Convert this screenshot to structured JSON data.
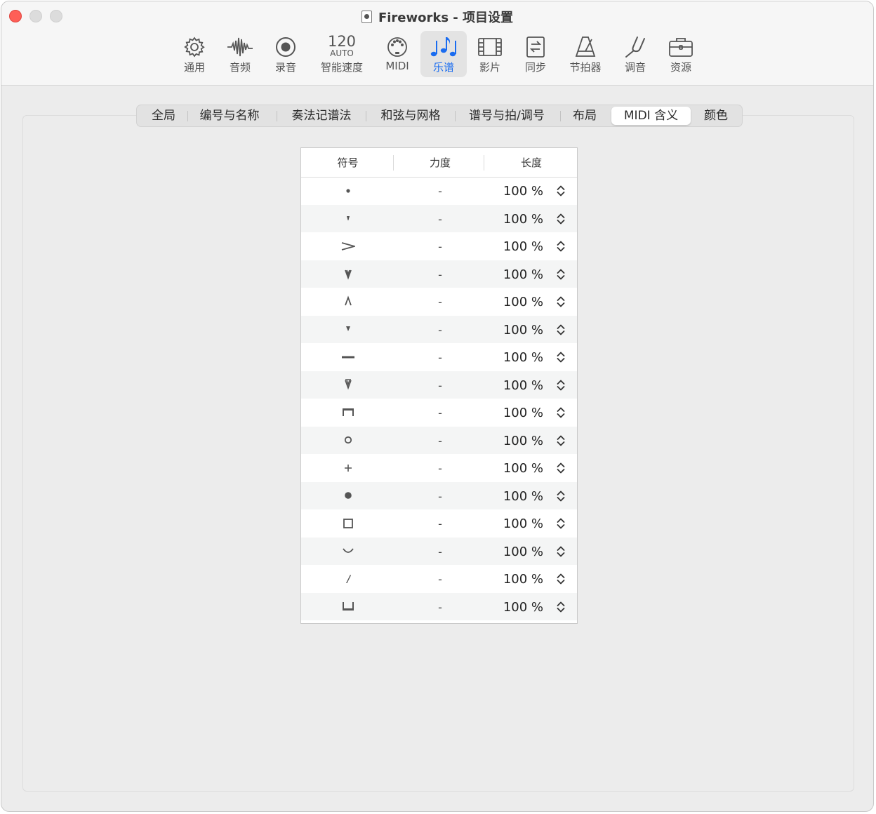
{
  "window": {
    "title": "Fireworks - 项目设置"
  },
  "toolbar": {
    "items": [
      {
        "id": "general",
        "label": "通用",
        "icon": "gear-icon"
      },
      {
        "id": "audio",
        "label": "音频",
        "icon": "waveform-icon"
      },
      {
        "id": "record",
        "label": "录音",
        "icon": "record-icon"
      },
      {
        "id": "smart-tempo",
        "label": "智能速度",
        "tempo": "120",
        "auto": "AUTO"
      },
      {
        "id": "midi",
        "label": "MIDI",
        "icon": "midi-port-icon"
      },
      {
        "id": "score",
        "label": "乐谱",
        "icon": "music-notes-icon",
        "active": true
      },
      {
        "id": "movie",
        "label": "影片",
        "icon": "film-icon"
      },
      {
        "id": "sync",
        "label": "同步",
        "icon": "sync-icon"
      },
      {
        "id": "metronome",
        "label": "节拍器",
        "icon": "metronome-icon"
      },
      {
        "id": "tuning",
        "label": "调音",
        "icon": "tuning-fork-icon"
      },
      {
        "id": "assets",
        "label": "资源",
        "icon": "briefcase-icon"
      }
    ]
  },
  "tabs": {
    "items": [
      "全局",
      "编号与名称",
      "奏法记谱法",
      "和弦与网格",
      "谱号与拍/调号",
      "布局",
      "MIDI 含义",
      "颜色"
    ],
    "selected": "MIDI 含义"
  },
  "table": {
    "headers": {
      "symbol": "符号",
      "velocity": "力度",
      "length": "长度"
    },
    "rows": [
      {
        "symbol": "staccato-dot",
        "velocity": "-",
        "length": "100 %"
      },
      {
        "symbol": "staccatissimo",
        "velocity": "-",
        "length": "100 %"
      },
      {
        "symbol": "accent",
        "velocity": "-",
        "length": "100 %"
      },
      {
        "symbol": "marcato-down",
        "velocity": "-",
        "length": "100 %"
      },
      {
        "symbol": "marcato-up",
        "velocity": "-",
        "length": "100 %"
      },
      {
        "symbol": "wedge",
        "velocity": "-",
        "length": "100 %"
      },
      {
        "symbol": "tenuto",
        "velocity": "-",
        "length": "100 %"
      },
      {
        "symbol": "tenuto-marcato",
        "velocity": "-",
        "length": "100 %"
      },
      {
        "symbol": "down-bow",
        "velocity": "-",
        "length": "100 %"
      },
      {
        "symbol": "harmonic-circle",
        "velocity": "-",
        "length": "100 %"
      },
      {
        "symbol": "plus-stopped",
        "velocity": "-",
        "length": "100 %"
      },
      {
        "symbol": "filled-dot",
        "velocity": "-",
        "length": "100 %"
      },
      {
        "symbol": "square",
        "velocity": "-",
        "length": "100 %"
      },
      {
        "symbol": "arc",
        "velocity": "-",
        "length": "100 %"
      },
      {
        "symbol": "slash-stroke",
        "velocity": "-",
        "length": "100 %"
      },
      {
        "symbol": "up-bracket",
        "velocity": "-",
        "length": "100 %"
      }
    ]
  },
  "colors": {
    "accent": "#1a6cf0",
    "close": "#fe5f57"
  }
}
